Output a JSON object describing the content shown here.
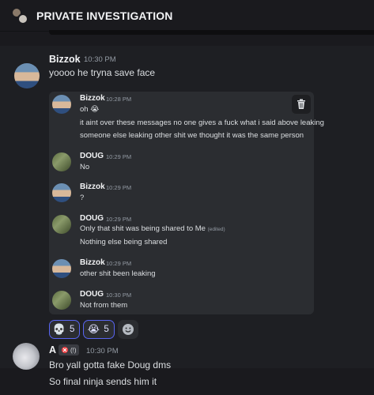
{
  "header": {
    "title": "PRIVATE INVESTIGATION"
  },
  "message": {
    "author": "Bizzok",
    "time": "10:30 PM",
    "text": "yoooo he tryna save face",
    "forwarded": [
      {
        "author": "Bizzok",
        "time": "10:28 PM",
        "lines": [
          "oh 😭",
          "it aint over these messages no one gives a fuck what i said above leaking",
          "someone else leaking other shit we thought it was the same person"
        ]
      },
      {
        "author": "DOUG",
        "time": "10:29 PM",
        "lines": [
          "No"
        ]
      },
      {
        "author": "Bizzok",
        "time": "10:29 PM",
        "lines": [
          "?"
        ]
      },
      {
        "author": "DOUG",
        "time": "10:29 PM",
        "lines": [
          "Only that shit was being shared to Me",
          "Nothing else being shared"
        ],
        "edited": "(edited)"
      },
      {
        "author": "Bizzok",
        "time": "10:29 PM",
        "lines": [
          "other shit been leaking"
        ]
      },
      {
        "author": "DOUG",
        "time": "10:30 PM",
        "lines": [
          "Not from them"
        ]
      }
    ],
    "reactions": [
      {
        "icon": "skull-icon",
        "emoji": "💀",
        "count": "5"
      },
      {
        "icon": "crying-face-icon",
        "emoji": "😭",
        "count": "5"
      }
    ]
  },
  "message2": {
    "author": "A",
    "badge_count": "(!)",
    "time": "10:30 PM",
    "lines": [
      "Bro yall gotta fake Doug dms",
      "So final ninja sends him it"
    ]
  },
  "colors": {
    "accent": "#5865f2",
    "background": "#1a1a1e",
    "embed": "#2b2d31"
  }
}
